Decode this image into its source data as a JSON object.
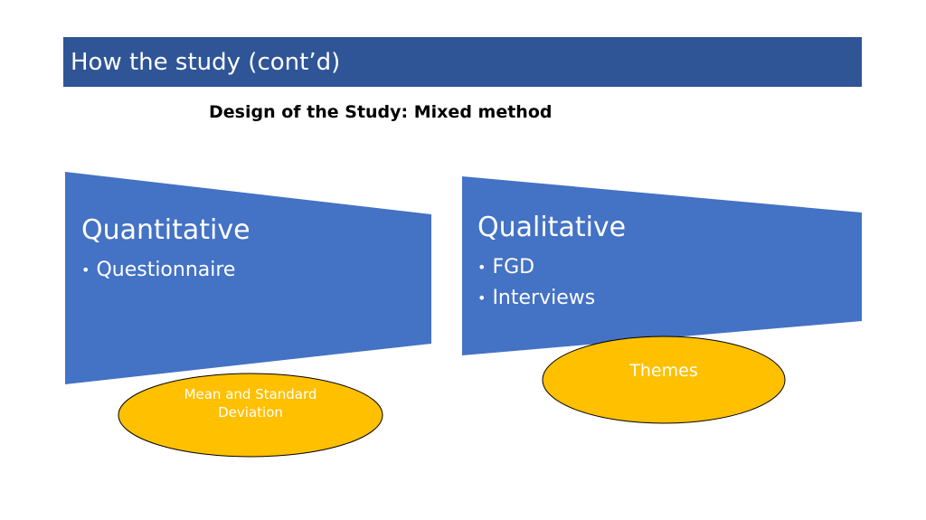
{
  "slide": {
    "title": "How the study (cont’d)",
    "subtitle": "Design of the Study: Mixed method"
  },
  "panels": [
    {
      "heading": "Quantitative",
      "bullets": [
        "Questionnaire"
      ],
      "oval": {
        "line1": "Mean and Standard",
        "line2": "Deviation"
      }
    },
    {
      "heading": "Qualitative",
      "bullets": [
        "FGD",
        "Interviews"
      ],
      "oval": {
        "line1": "Themes"
      }
    }
  ],
  "colors": {
    "title_bar": "#2f5597",
    "panel": "#4472c4",
    "oval_fill": "#ffc000",
    "oval_stroke": "#000000",
    "text_light": "#ffffff"
  }
}
